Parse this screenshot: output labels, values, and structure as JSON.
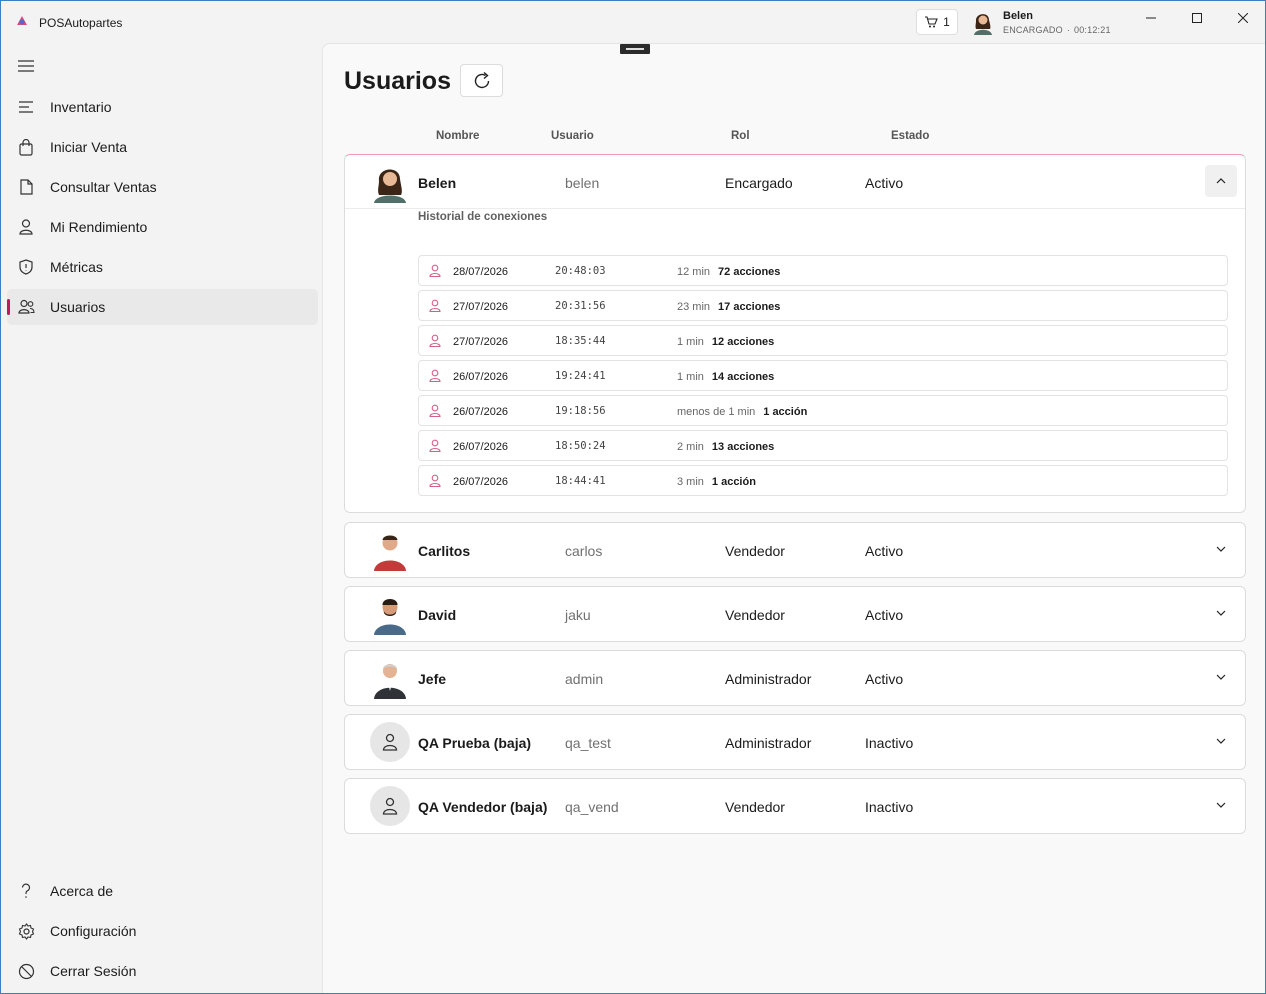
{
  "app": {
    "title": "POSAutopartes"
  },
  "topbar": {
    "cart_count": "1",
    "user_name": "Belen",
    "user_role": "ENCARGADO",
    "session_time": "00:12:21",
    "separator": "·"
  },
  "sidebar": {
    "items": [
      {
        "label": "Inventario",
        "icon": "list-icon"
      },
      {
        "label": "Iniciar Venta",
        "icon": "shopping-bag-icon"
      },
      {
        "label": "Consultar Ventas",
        "icon": "document-icon"
      },
      {
        "label": "Mi Rendimiento",
        "icon": "person-icon"
      },
      {
        "label": "Métricas",
        "icon": "shield-icon"
      },
      {
        "label": "Usuarios",
        "icon": "people-icon",
        "active": true
      }
    ],
    "bottom": [
      {
        "label": "Acerca de",
        "icon": "question-icon"
      },
      {
        "label": "Configuración",
        "icon": "gear-icon"
      },
      {
        "label": "Cerrar Sesión",
        "icon": "logout-icon"
      }
    ]
  },
  "main": {
    "title": "Usuarios",
    "columns": [
      "Nombre",
      "Usuario",
      "Rol",
      "Estado"
    ],
    "history_title": "Historial de conexiones",
    "users": [
      {
        "name": "Belen",
        "username": "belen",
        "role": "Encargado",
        "state": "Activo",
        "expanded": true
      },
      {
        "name": "Carlitos",
        "username": "carlos",
        "role": "Vendedor",
        "state": "Activo"
      },
      {
        "name": "David",
        "username": "jaku",
        "role": "Vendedor",
        "state": "Activo"
      },
      {
        "name": "Jefe",
        "username": "admin",
        "role": "Administrador",
        "state": "Activo"
      },
      {
        "name": "QA Prueba (baja)",
        "username": "qa_test",
        "role": "Administrador",
        "state": "Inactivo"
      },
      {
        "name": "QA Vendedor (baja)",
        "username": "qa_vend",
        "role": "Vendedor",
        "state": "Inactivo"
      }
    ],
    "history": [
      {
        "date": "28/07/2026",
        "time": "20:48:03",
        "duration": "12 min",
        "actions": "72 acciones"
      },
      {
        "date": "27/07/2026",
        "time": "20:31:56",
        "duration": "23 min",
        "actions": "17 acciones"
      },
      {
        "date": "27/07/2026",
        "time": "18:35:44",
        "duration": "1 min",
        "actions": "12 acciones"
      },
      {
        "date": "26/07/2026",
        "time": "19:24:41",
        "duration": "1 min",
        "actions": "14 acciones"
      },
      {
        "date": "26/07/2026",
        "time": "19:18:56",
        "duration": "menos de 1 min",
        "actions": "1 acción"
      },
      {
        "date": "26/07/2026",
        "time": "18:50:24",
        "duration": "2 min",
        "actions": "13 acciones"
      },
      {
        "date": "26/07/2026",
        "time": "18:44:41",
        "duration": "3 min",
        "actions": "1 acción"
      }
    ]
  },
  "colors": {
    "accent": "#c2185b",
    "history_icon": "#d4608a"
  }
}
